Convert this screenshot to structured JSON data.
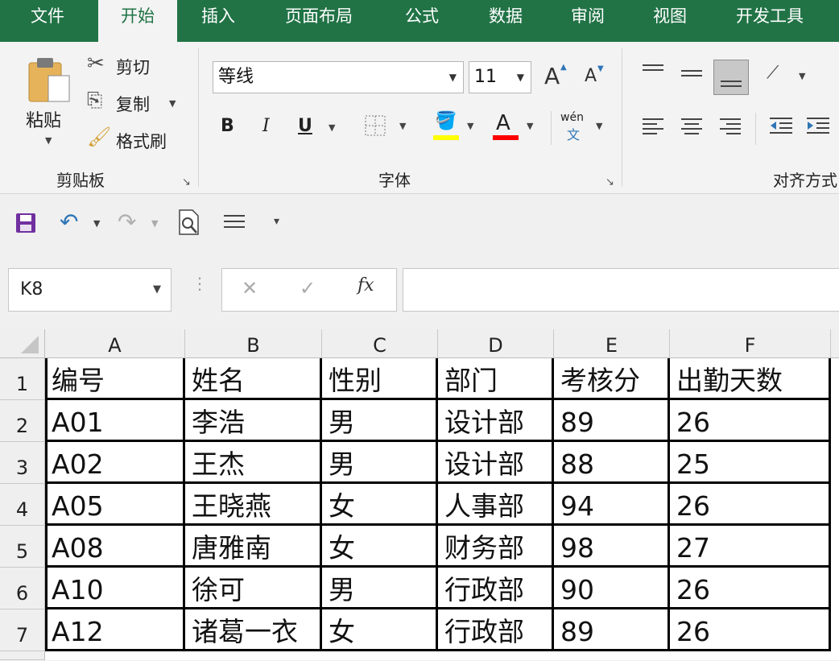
{
  "tabs": [
    {
      "label": "文件",
      "active": false
    },
    {
      "label": "开始",
      "active": true
    },
    {
      "label": "插入",
      "active": false
    },
    {
      "label": "页面布局",
      "active": false
    },
    {
      "label": "公式",
      "active": false
    },
    {
      "label": "数据",
      "active": false
    },
    {
      "label": "审阅",
      "active": false
    },
    {
      "label": "视图",
      "active": false
    },
    {
      "label": "开发工具",
      "active": false
    }
  ],
  "clipboard": {
    "paste_label": "粘贴",
    "cut_label": "剪切",
    "copy_label": "复制",
    "format_painter_label": "格式刷",
    "group_label": "剪贴板"
  },
  "font": {
    "font_name": "等线",
    "font_size": "11",
    "group_label": "字体",
    "bold": "B",
    "italic": "I",
    "underline": "U",
    "font_color_letter": "A",
    "grow_letter": "A",
    "shrink_letter": "A",
    "phonetic_top": "wén",
    "phonetic_bottom": "文",
    "fill_color": "#ffff00",
    "font_color": "#ff0000"
  },
  "alignment": {
    "group_label": "对齐方式"
  },
  "namebox": {
    "value": "K8"
  },
  "formula": {
    "fx": "fx",
    "value": ""
  },
  "sheet": {
    "columns": [
      "A",
      "B",
      "C",
      "D",
      "E",
      "F"
    ],
    "rows": [
      {
        "num": "1",
        "cells": [
          "编号",
          "姓名",
          "性别",
          "部门",
          "考核分",
          "出勤天数"
        ]
      },
      {
        "num": "2",
        "cells": [
          "A01",
          "李浩",
          "男",
          "设计部",
          "89",
          "26"
        ]
      },
      {
        "num": "3",
        "cells": [
          "A02",
          "王杰",
          "男",
          "设计部",
          "88",
          "25"
        ]
      },
      {
        "num": "4",
        "cells": [
          "A05",
          "王晓燕",
          "女",
          "人事部",
          "94",
          "26"
        ]
      },
      {
        "num": "5",
        "cells": [
          "A08",
          "唐雅南",
          "女",
          "财务部",
          "98",
          "27"
        ]
      },
      {
        "num": "6",
        "cells": [
          "A10",
          "徐可",
          "男",
          "行政部",
          "90",
          "26"
        ]
      },
      {
        "num": "7",
        "cells": [
          "A12",
          "诸葛一衣",
          "女",
          "行政部",
          "89",
          "26"
        ]
      }
    ]
  },
  "colors": {
    "excel_green": "#217346",
    "accent_purple": "#7030a0",
    "accent_blue": "#2e75b6"
  }
}
